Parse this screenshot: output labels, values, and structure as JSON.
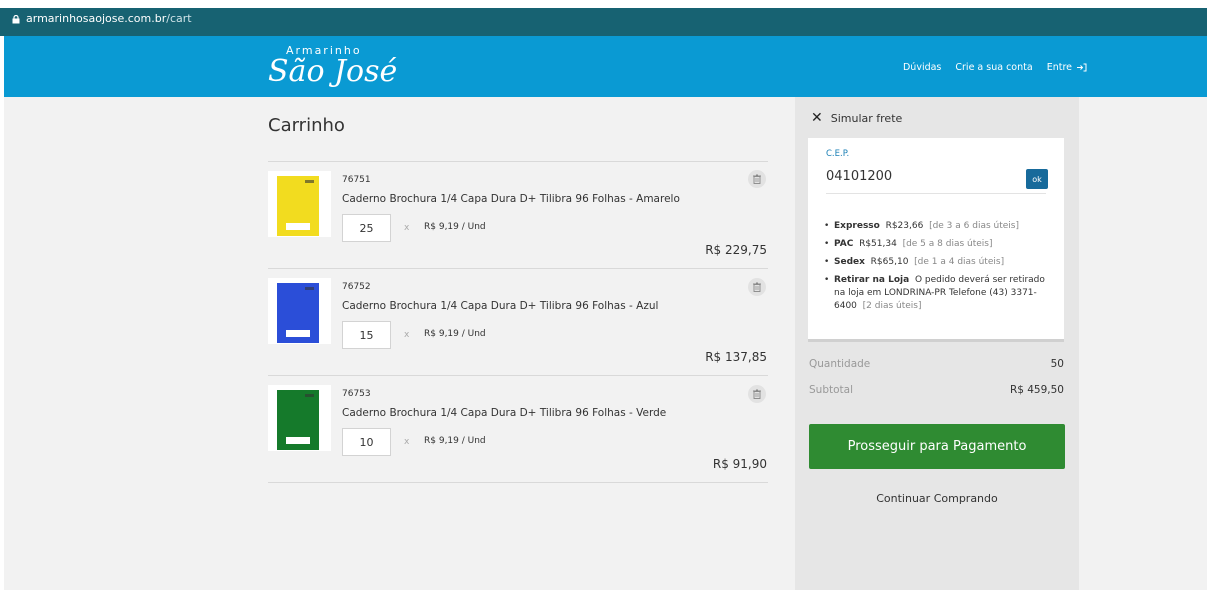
{
  "browser": {
    "domain": "armarinhosaojose.com.br",
    "path": "/cart"
  },
  "header": {
    "logo_top": "Armarinho",
    "logo_main": "São José",
    "nav": {
      "duvidas": "Dúvidas",
      "create_account": "Crie a sua conta",
      "login": "Entre"
    }
  },
  "cart": {
    "title": "Carrinho",
    "items": [
      {
        "sku": "76751",
        "name": "Caderno Brochura 1/4 Capa Dura D+ Tilibra 96 Folhas - Amarelo",
        "qty": "25",
        "times": "x",
        "unit_price": "R$ 9,19 / Und",
        "total": "R$ 229,75",
        "cover_color": "#f2dc1f"
      },
      {
        "sku": "76752",
        "name": "Caderno Brochura 1/4 Capa Dura D+ Tilibra 96 Folhas - Azul",
        "qty": "15",
        "times": "x",
        "unit_price": "R$ 9,19 / Und",
        "total": "R$ 137,85",
        "cover_color": "#2b4ed8"
      },
      {
        "sku": "76753",
        "name": "Caderno Brochura 1/4 Capa Dura D+ Tilibra 96 Folhas - Verde",
        "qty": "10",
        "times": "x",
        "unit_price": "R$ 9,19 / Und",
        "total": "R$ 91,90",
        "cover_color": "#157a2b"
      }
    ]
  },
  "shipping": {
    "title": "Simular frete",
    "cep_label": "C.E.P.",
    "cep_value": "04101200",
    "ok_label": "ok",
    "options": [
      {
        "name": "Expresso",
        "price": "R$23,66",
        "detail": "[de 3 a 6 dias úteis]"
      },
      {
        "name": "PAC",
        "price": "R$51,34",
        "detail": "[de 5 a 8 dias úteis]"
      },
      {
        "name": "Sedex",
        "price": "R$65,10",
        "detail": "[de 1 a 4 dias úteis]"
      },
      {
        "name": "Retirar na Loja",
        "price": "O pedido deverá ser retirado na loja em LONDRINA-PR Telefone (43) 3371-6400",
        "detail": "[2 dias úteis]"
      }
    ]
  },
  "summary": {
    "quantity_label": "Quantidade",
    "quantity_value": "50",
    "subtotal_label": "Subtotal",
    "subtotal_value": "R$ 459,50"
  },
  "actions": {
    "proceed": "Prosseguir para Pagamento",
    "continue": "Continuar Comprando"
  },
  "colors": {
    "browser_bar": "#176272",
    "header": "#0a9ad3",
    "primary_button": "#2f8b32",
    "ok_button": "#176a9b"
  }
}
